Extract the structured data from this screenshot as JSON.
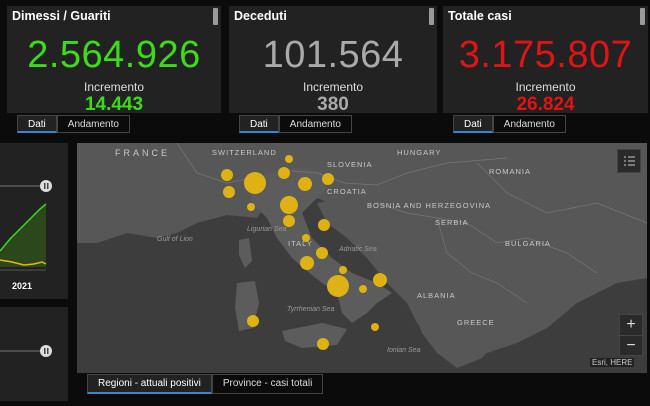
{
  "cards": [
    {
      "title": "Dimessi / Guariti",
      "value": "2.564.926",
      "sub": "Incremento",
      "increment": "14.443",
      "color": "#3ddc18"
    },
    {
      "title": "Deceduti",
      "value": "101.564",
      "sub": "Incremento",
      "increment": "380",
      "color": "#aaaaaa"
    },
    {
      "title": "Totale casi",
      "value": "3.175.807",
      "sub": "Incremento",
      "increment": "26.824",
      "color": "#e01414"
    }
  ],
  "tab_labels": {
    "dati": "Dati",
    "andamento": "Andamento"
  },
  "left_chart": {
    "year_label": "2021"
  },
  "map": {
    "labels": {
      "france": "FRANCE",
      "switzerland": "SWITZERLAND",
      "slovenia": "SLOVENIA",
      "hungary": "HUNGARY",
      "romania": "ROMANIA",
      "croatia": "CROATIA",
      "bosnia": "BOSNIA AND HERZEGOVINA",
      "serbia": "SERBIA",
      "bulgaria": "BULGARIA",
      "italy": "ITALY",
      "albania": "ALBANIA",
      "greece": "GREECE",
      "gulf_of_lion": "Gulf of Lion",
      "ligurian_sea": "Ligurian Sea",
      "adriatic_sea": "Adriatic Sea",
      "tyrrhenian_sea": "Tyrrhenian Sea",
      "ionian_sea": "Ionian Sea"
    },
    "zoom_in": "+",
    "zoom_out": "−",
    "attribution": "Esri, HERE"
  },
  "bottom_tabs": [
    "Regioni - attuali positivi",
    "Province - casi totali"
  ],
  "colors": {
    "accent": "#3a84d1",
    "bubble": "#e6b711"
  }
}
